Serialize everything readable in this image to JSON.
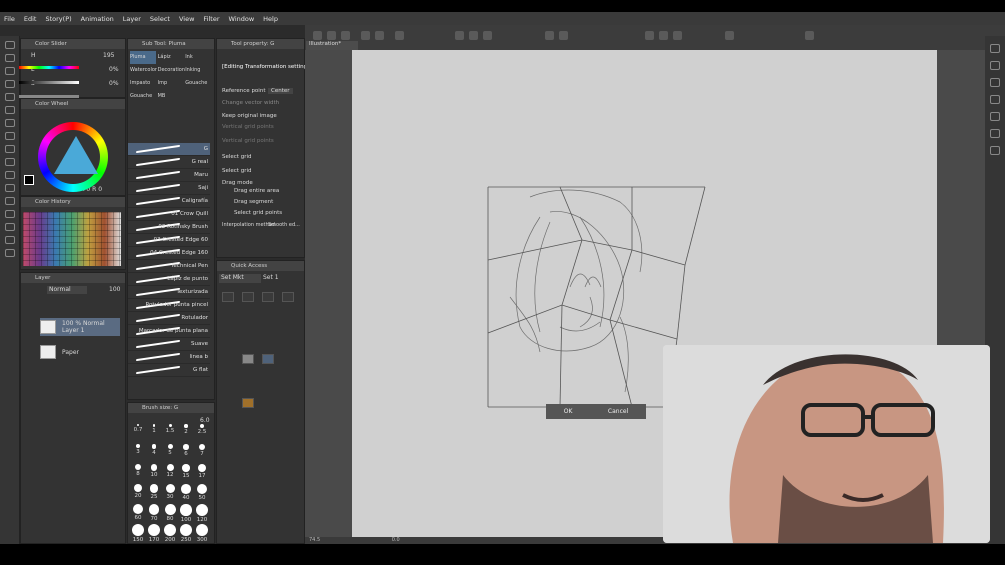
{
  "menu": [
    "File",
    "Edit",
    "Story(P)",
    "Animation",
    "Layer",
    "Select",
    "View",
    "Filter",
    "Window",
    "Help"
  ],
  "color_slider": {
    "title": "Color Slider",
    "h_label": "H",
    "h_value": "195",
    "l_label": "L",
    "l_value": "0%",
    "s_label": "S",
    "s_value": "0%"
  },
  "color_wheel": {
    "title": "Color Wheel",
    "readout": "155 R  0 R  0"
  },
  "color_history": {
    "title": "Color History"
  },
  "sub_tool": {
    "title": "Sub Tool: Pluma",
    "tools": [
      "Pluma",
      "Lápiz",
      "Ink",
      "Watercolor",
      "Decoration",
      "Inking",
      "Impasto",
      "Imp",
      "Gouache",
      "Gouache",
      "MB"
    ]
  },
  "brushes": [
    "G",
    "G real",
    "Maru",
    "Saji",
    "Caligrafía",
    "01 Crow Quill",
    "02 Rotinsky Brush",
    "03 Crested Edge 60",
    "04 Crested Edge 160",
    "Technical Pen",
    "Lápiz de punto",
    "Texturizada",
    "Rotulador punta pincel",
    "Rotulador",
    "Marcador de punta plana",
    "Suave",
    "linea b",
    "G flat"
  ],
  "brush_size": {
    "title": "Brush size: G",
    "value": "6.0",
    "sizes": [
      "0.7",
      "1",
      "1.5",
      "2",
      "2.5",
      "3",
      "4",
      "5",
      "6",
      "7",
      "8",
      "10",
      "12",
      "15",
      "17",
      "20",
      "25",
      "30",
      "40",
      "50",
      "60",
      "70",
      "80",
      "100",
      "120",
      "150",
      "170",
      "200",
      "250",
      "300"
    ]
  },
  "tool_property": {
    "title": "Tool property: G",
    "editing": "[Editing Transformation settings]",
    "reference_point_label": "Reference point",
    "reference_point_value": "Center",
    "change_vector_width": "Change vector width",
    "keep_original_image": "Keep original image",
    "vertical_grid_points": "Vertical grid points",
    "horizontal_grid_points": "Vertical grid points",
    "select_grid_1": "Select grid",
    "select_grid_2": "Select grid",
    "drag_mode": "Drag mode",
    "drag_entire_area": "Drag entire area",
    "drag_segment": "Drag segment",
    "select_grid_points": "Select grid points",
    "interpolation_label": "Interpolation method",
    "interpolation_value": "Smooth ed..."
  },
  "quick_access": {
    "title": "Quick Access",
    "set_a": "Set Mkt",
    "set_b": "Set 1"
  },
  "layers": {
    "title": "Layer",
    "blend": "Normal",
    "opacity": "100",
    "layer1_mode": "100 % Normal",
    "layer1_name": "Layer 1",
    "paper_name": "Paper"
  },
  "canvas": {
    "tab": "Illustration*",
    "zoom": "74.5",
    "coords": "0.0"
  },
  "transform_dialog": {
    "ok": "OK",
    "cancel": "Cancel"
  },
  "colors": {
    "accent": "#4aa9d8",
    "bg": "#2b2b2b",
    "panel": "#333333",
    "canvas": "#d0d0d0"
  }
}
